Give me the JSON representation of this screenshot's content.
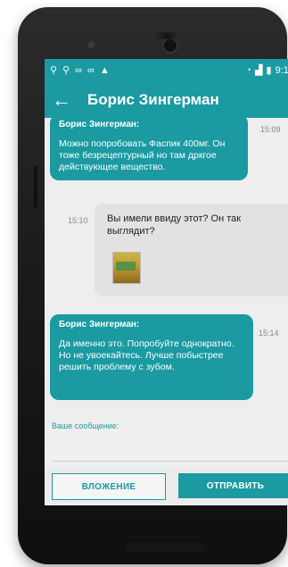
{
  "statusbar": {
    "left_icons": [
      "search-icon",
      "search-icon",
      "voicemail-icon",
      "voicemail-icon",
      "warning-icon"
    ],
    "time": "9:14"
  },
  "appbar": {
    "title": "Борис Зингерман"
  },
  "messages": [
    {
      "direction": "in",
      "sender": "Борис Зингерман:",
      "text": "Можно попробовать Фаспик 400мг. Он тоже безрецептурный но там дркгое действующее вещество.",
      "time": "15:09"
    },
    {
      "direction": "out",
      "text": "Вы имели ввиду этот? Он так выглядит?",
      "time": "15:10",
      "has_image": true
    },
    {
      "direction": "in",
      "sender": "Борис Зингерман:",
      "text": "Да именно это. Попробуйте однократно. Но не увоекайтесь. Лучше побыстрее решить проблему с зубом.",
      "time": "15:14"
    }
  ],
  "composer": {
    "label": "Ваше сообщение:",
    "attach_label": "ВЛОЖЕНИЕ",
    "send_label": "ОТПРАВИТЬ"
  },
  "colors": {
    "accent": "#1b9aa2",
    "outgoing_bubble": "#e2e2e2",
    "background": "#eeeeee"
  }
}
